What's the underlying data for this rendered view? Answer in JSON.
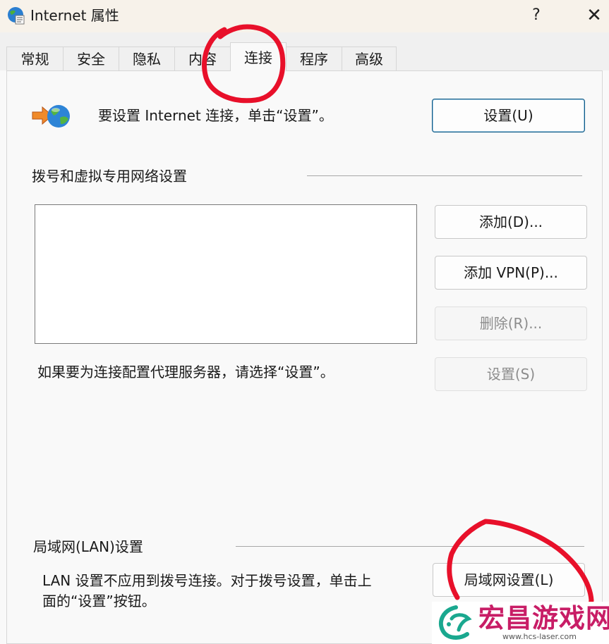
{
  "window": {
    "title": "Internet 属性",
    "help": "?",
    "close": "✕"
  },
  "tabs": [
    {
      "label": "常规"
    },
    {
      "label": "安全"
    },
    {
      "label": "隐私"
    },
    {
      "label": "内容"
    },
    {
      "label": "连接",
      "active": true
    },
    {
      "label": "程序"
    },
    {
      "label": "高级"
    }
  ],
  "setup": {
    "text": "要设置 Internet 连接，单击“设置”。",
    "button": "设置(U)",
    "icon": "internet-connect-icon"
  },
  "dialup": {
    "heading": "拨号和虚拟专用网络设置",
    "connections": [],
    "add_button": "添加(D)...",
    "add_vpn_button": "添加 VPN(P)...",
    "delete_button": "删除(R)...",
    "proxy_text": "如果要为连接配置代理服务器，请选择“设置”。",
    "settings_button": "设置(S)"
  },
  "lan": {
    "heading": "局域网(LAN)设置",
    "text_line1": "LAN 设置不应用到拨号连接。对于拨号设置，单击上",
    "text_line2": "面的“设置”按钮。",
    "button": "局域网设置(L)"
  },
  "watermark": {
    "brand": "宏昌游戏网",
    "url": "www.hcs-laser.com"
  },
  "colors": {
    "annotation": "#e8102a",
    "watermark": "#c81d66",
    "primary_border": "#0f5a86"
  }
}
